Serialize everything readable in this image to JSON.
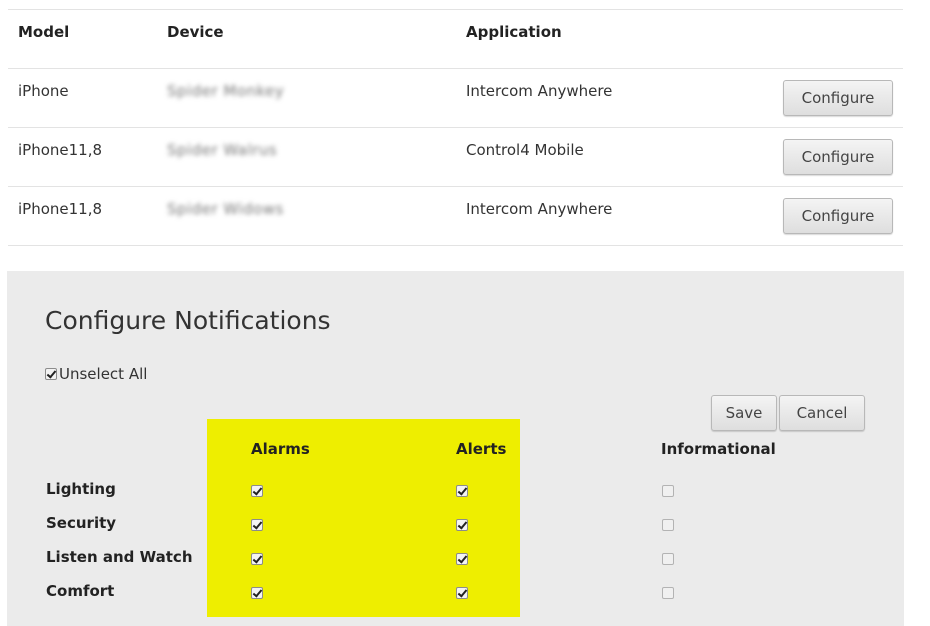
{
  "table": {
    "headers": {
      "model": "Model",
      "device": "Device",
      "application": "Application"
    },
    "rows": [
      {
        "model": "iPhone",
        "device": "Spider Monkey",
        "application": "Intercom Anywhere",
        "button": "Configure"
      },
      {
        "model": "iPhone11,8",
        "device": "Spider Walrus",
        "application": "Control4 Mobile",
        "button": "Configure"
      },
      {
        "model": "iPhone11,8",
        "device": "Spider Widows",
        "application": "Intercom Anywhere",
        "button": "Configure"
      }
    ]
  },
  "notifications": {
    "title": "Configure Notifications",
    "unselect_all": {
      "label": "Unselect All",
      "checked": true
    },
    "save_label": "Save",
    "cancel_label": "Cancel",
    "columns": [
      "Alarms",
      "Alerts",
      "Informational"
    ],
    "highlight_color": "#eeee00",
    "categories": [
      {
        "label": "Lighting",
        "alarms": true,
        "alerts": true,
        "informational": false
      },
      {
        "label": "Security",
        "alarms": true,
        "alerts": true,
        "informational": false
      },
      {
        "label": "Listen and Watch",
        "alarms": true,
        "alerts": true,
        "informational": false
      },
      {
        "label": "Comfort",
        "alarms": true,
        "alerts": true,
        "informational": false
      }
    ]
  }
}
